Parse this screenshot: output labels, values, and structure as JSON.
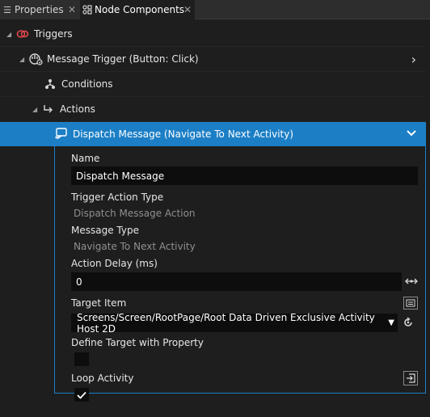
{
  "tabs": [
    {
      "label": "Properties",
      "icon": "list-icon",
      "close": "✕"
    },
    {
      "label": "Node Components",
      "icon": "node-components-icon",
      "close": "✕"
    }
  ],
  "tree": {
    "triggers_label": "Triggers",
    "message_trigger_label": "Message Trigger (Button: Click)",
    "conditions_label": "Conditions",
    "actions_label": "Actions",
    "dispatch_label": "Dispatch Message (Navigate To Next Activity)"
  },
  "properties": {
    "name_label": "Name",
    "name_value": "Dispatch Message",
    "trigger_action_type_label": "Trigger Action Type",
    "trigger_action_type_value": "Dispatch Message Action",
    "message_type_label": "Message Type",
    "message_type_value": "Navigate To Next Activity",
    "action_delay_label": "Action Delay (ms)",
    "action_delay_value": "0",
    "target_item_label": "Target Item",
    "target_item_value": "Screens/Screen/RootPage/Root Data Driven Exclusive Activity Host 2D",
    "define_target_label": "Define Target with Property",
    "define_target_checked": false,
    "loop_activity_label": "Loop Activity",
    "loop_activity_checked": true
  },
  "colors": {
    "accent": "#1c7fc6",
    "background": "#1e1e1e",
    "field": "#0d0d0d",
    "trigger_icon": "#e0474c"
  }
}
